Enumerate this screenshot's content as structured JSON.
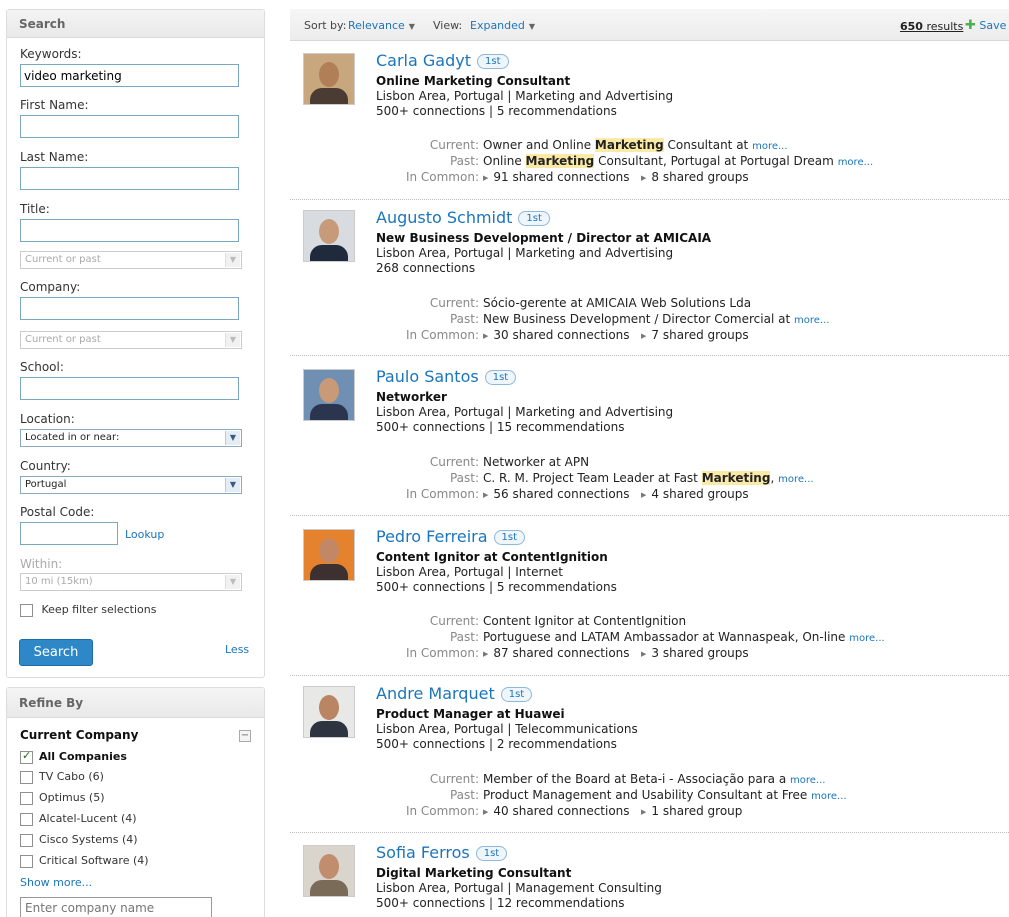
{
  "search": {
    "title": "Search",
    "keywords_label": "Keywords:",
    "keywords_value": "video marketing",
    "first_name_label": "First Name:",
    "last_name_label": "Last Name:",
    "title_label": "Title:",
    "title_scope": "Current or past",
    "company_label": "Company:",
    "company_scope": "Current or past",
    "school_label": "School:",
    "location_label": "Location:",
    "location_value": "Located in or near:",
    "country_label": "Country:",
    "country_value": "Portugal",
    "postal_label": "Postal Code:",
    "lookup_label": "Lookup",
    "within_label": "Within:",
    "within_value": "10 mi (15km)",
    "keep_filter_label": "Keep filter selections",
    "search_button": "Search",
    "less_link": "Less"
  },
  "refine": {
    "title": "Refine By",
    "section_title": "Current Company",
    "items": [
      {
        "label": "All Companies",
        "checked": true
      },
      {
        "label": "TV Cabo (6)",
        "checked": false
      },
      {
        "label": "Optimus (5)",
        "checked": false
      },
      {
        "label": "Alcatel-Lucent (4)",
        "checked": false
      },
      {
        "label": "Cisco Systems (4)",
        "checked": false
      },
      {
        "label": "Critical Software (4)",
        "checked": false
      }
    ],
    "show_more": "Show more...",
    "company_placeholder": "Enter company name"
  },
  "results_bar": {
    "sort_label": "Sort by:",
    "sort_value": "Relevance",
    "view_label": "View:",
    "view_value": "Expanded",
    "count_number": "650",
    "count_word": "results",
    "save_label": "Save"
  },
  "labels": {
    "current": "Current:",
    "past": "Past:",
    "in_common": "In Common:",
    "more": "more...",
    "degree": "1st"
  },
  "results": [
    {
      "name": "Carla Gadyt",
      "headline": "Online Marketing Consultant",
      "location": "Lisbon Area, Portugal | Marketing and Advertising",
      "connections": "500+ connections | 5 recommendations",
      "current_pre": "Owner and Online ",
      "current_hl": "Marketing",
      "current_post": " Consultant at",
      "current_more": true,
      "past_pre": "Online ",
      "past_hl": "Marketing",
      "past_post": " Consultant, Portugal at Portugal Dream",
      "past_more": true,
      "shared_connections": "91 shared connections",
      "shared_groups": "8 shared groups"
    },
    {
      "name": "Augusto Schmidt",
      "headline": "New Business Development / Director at AMICAIA",
      "location": "Lisbon Area, Portugal | Marketing and Advertising",
      "connections": "268 connections",
      "current_pre": "Sócio-gerente at AMICAIA Web Solutions Lda",
      "current_hl": "",
      "current_post": "",
      "current_more": false,
      "past_pre": "New Business Development / Director Comercial at",
      "past_hl": "",
      "past_post": "",
      "past_more": true,
      "shared_connections": "30 shared connections",
      "shared_groups": "7 shared groups"
    },
    {
      "name": "Paulo Santos",
      "headline": "Networker",
      "location": "Lisbon Area, Portugal | Marketing and Advertising",
      "connections": "500+ connections | 15 recommendations",
      "current_pre": "Networker at APN",
      "current_hl": "",
      "current_post": "",
      "current_more": false,
      "past_pre": "C. R. M. Project Team Leader at Fast ",
      "past_hl": "Marketing",
      "past_post": ",",
      "past_more": true,
      "shared_connections": "56 shared connections",
      "shared_groups": "4 shared groups"
    },
    {
      "name": "Pedro Ferreira",
      "headline": "Content Ignitor at ContentIgnition",
      "location": "Lisbon Area, Portugal | Internet",
      "connections": "500+ connections | 5 recommendations",
      "current_pre": "Content Ignitor at ContentIgnition",
      "current_hl": "",
      "current_post": "",
      "current_more": false,
      "past_pre": "Portuguese and LATAM Ambassador at Wannaspeak, On-line",
      "past_hl": "",
      "past_post": "",
      "past_more": true,
      "shared_connections": "87 shared connections",
      "shared_groups": "3 shared groups"
    },
    {
      "name": "Andre Marquet",
      "headline": "Product Manager at Huawei",
      "location": "Lisbon Area, Portugal | Telecommunications",
      "connections": "500+ connections | 2 recommendations",
      "current_pre": "Member of the Board at Beta-i - Associação para a",
      "current_hl": "",
      "current_post": "",
      "current_more": true,
      "past_pre": "Product Management and Usability Consultant at Free",
      "past_hl": "",
      "past_post": "",
      "past_more": true,
      "shared_connections": "40 shared connections",
      "shared_groups": "1 shared group"
    },
    {
      "name": "Sofia Ferros",
      "headline": "Digital Marketing Consultant",
      "location": "Lisbon Area, Portugal | Management Consulting",
      "connections": "500+ connections | 12 recommendations"
    }
  ]
}
